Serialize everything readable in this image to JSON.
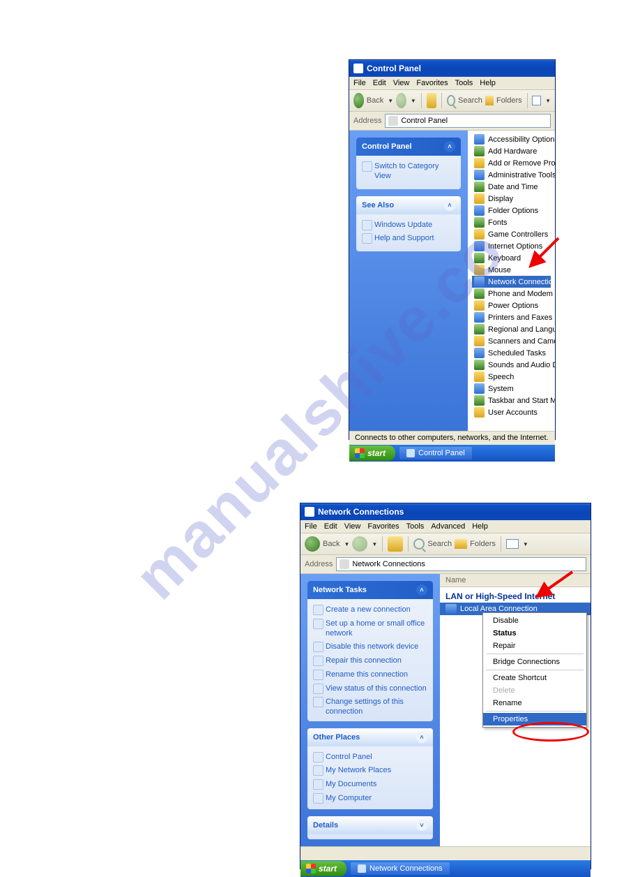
{
  "watermark": "manualshive.co",
  "screenshot1": {
    "title": "Control Panel",
    "menu": [
      "File",
      "Edit",
      "View",
      "Favorites",
      "Tools",
      "Help"
    ],
    "toolbar": {
      "back": "Back",
      "search": "Search",
      "folders": "Folders"
    },
    "address_label": "Address",
    "address_value": "Control Panel",
    "sidebar": {
      "panel_title": "Control Panel",
      "switch_view": "Switch to Category View",
      "see_also_title": "See Also",
      "see_also": [
        "Windows Update",
        "Help and Support"
      ]
    },
    "items": [
      "Accessibility Options",
      "Add Hardware",
      "Add or Remove Programs",
      "Administrative Tools",
      "Date and Time",
      "Display",
      "Folder Options",
      "Fonts",
      "Game Controllers",
      "Internet Options",
      "Keyboard",
      "Mouse",
      "Network Connections",
      "Phone and Modem Options",
      "Power Options",
      "Printers and Faxes",
      "Regional and Language Options",
      "Scanners and Cameras",
      "Scheduled Tasks",
      "Sounds and Audio Devices",
      "Speech",
      "System",
      "Taskbar and Start Menu",
      "User Accounts"
    ],
    "selected_index": 12,
    "statusbar": "Connects to other computers, networks, and the Internet.",
    "start": "start",
    "taskbar_tab": "Control Panel"
  },
  "screenshot2": {
    "title": "Network Connections",
    "menu": [
      "File",
      "Edit",
      "View",
      "Favorites",
      "Tools",
      "Advanced",
      "Help"
    ],
    "toolbar": {
      "back": "Back",
      "search": "Search",
      "folders": "Folders"
    },
    "address_label": "Address",
    "address_value": "Network Connections",
    "sidebar": {
      "tasks_title": "Network Tasks",
      "tasks": [
        "Create a new connection",
        "Set up a home or small office network",
        "Disable this network device",
        "Repair this connection",
        "Rename this connection",
        "View status of this connection",
        "Change settings of this connection"
      ],
      "other_title": "Other Places",
      "other": [
        "Control Panel",
        "My Network Places",
        "My Documents",
        "My Computer"
      ],
      "details_title": "Details"
    },
    "column_header": "Name",
    "group_header": "LAN or High-Speed Internet",
    "connection_item": "Local Area Connection",
    "context_menu": {
      "items": [
        "Disable",
        "Status",
        "Repair",
        "Bridge Connections",
        "Create Shortcut",
        "Delete",
        "Rename",
        "Properties"
      ],
      "bold_index": 1,
      "disabled_index": 5,
      "selected_index": 7,
      "separators_after": [
        2,
        3,
        6
      ]
    },
    "start": "start",
    "taskbar_tab": "Network Connections"
  }
}
